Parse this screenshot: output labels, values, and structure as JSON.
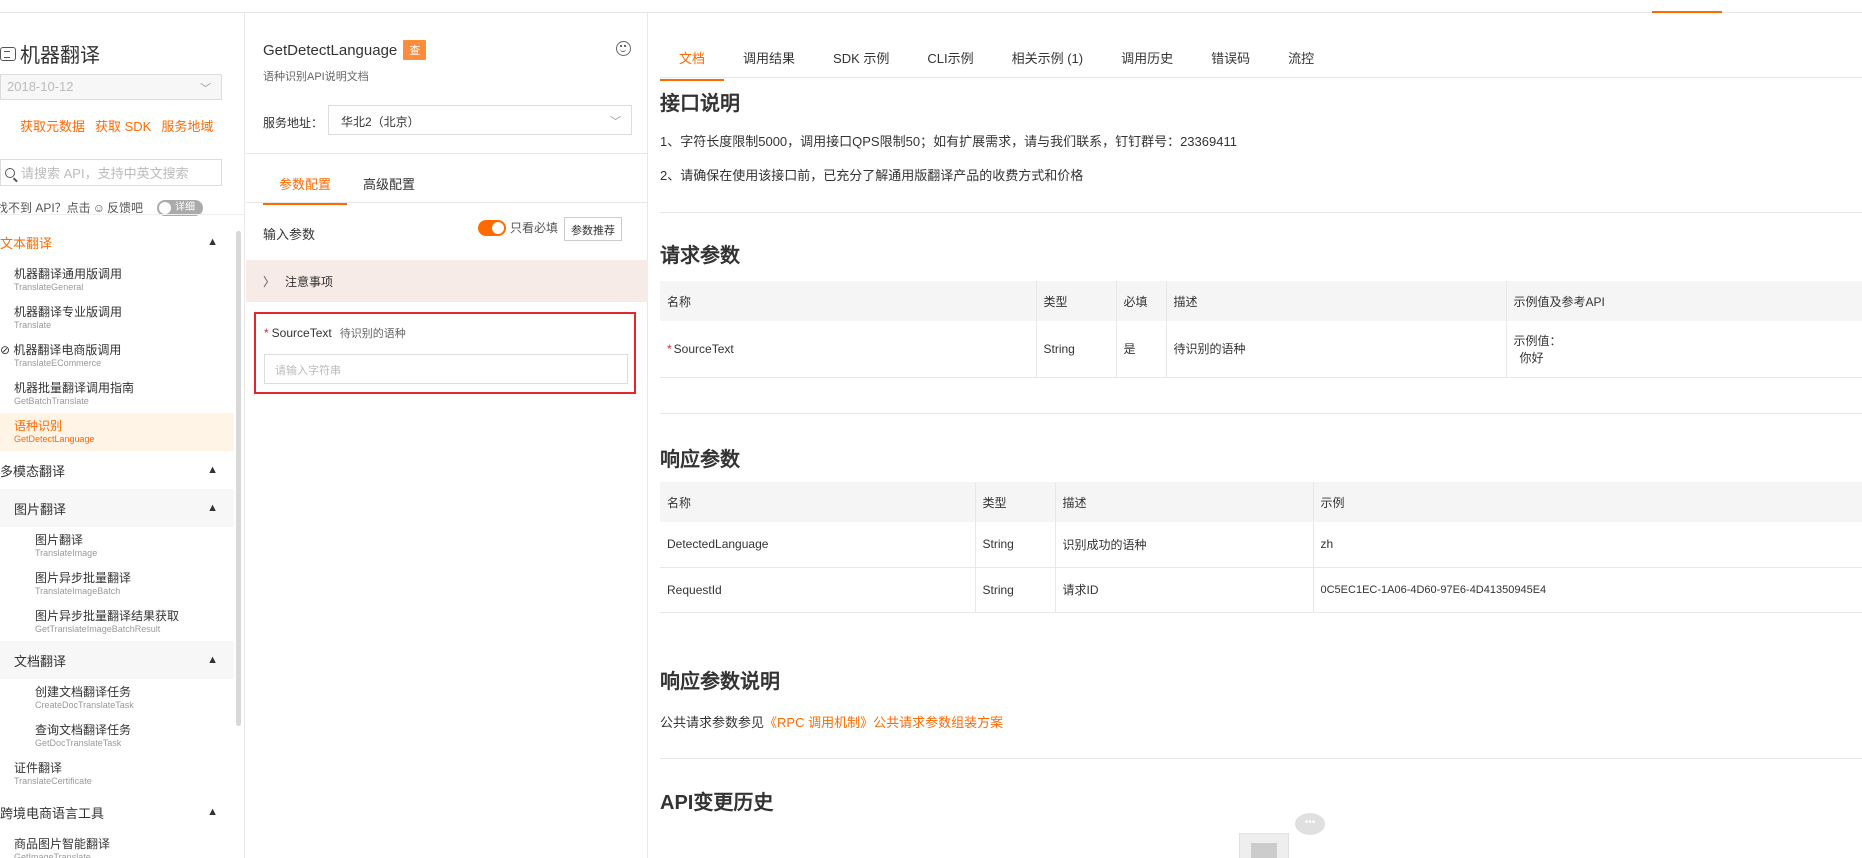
{
  "sidebar": {
    "title": "机器翻译",
    "date_value": "2018-10-12",
    "links": [
      "获取元数据",
      "获取 SDK",
      "服务地域"
    ],
    "search_placeholder": "请搜索 API，支持中英文搜索",
    "feedback_text": "找不到 API？点击",
    "feedback_link": "反馈吧",
    "detail_toggle": "详细",
    "nav": [
      {
        "type": "group",
        "label": "文本翻译",
        "active": true
      },
      {
        "type": "item",
        "cn": "机器翻译通用版调用",
        "en": "TranslateGeneral"
      },
      {
        "type": "item",
        "cn": "机器翻译专业版调用",
        "en": "Translate"
      },
      {
        "type": "item",
        "cn": "机器翻译电商版调用",
        "en": "TranslateECommerce",
        "disabled_icon": true
      },
      {
        "type": "item",
        "cn": "机器批量翻译调用指南",
        "en": "GetBatchTranslate"
      },
      {
        "type": "item",
        "cn": "语种识别",
        "en": "GetDetectLanguage",
        "active": true
      },
      {
        "type": "group",
        "label": "多模态翻译"
      },
      {
        "type": "subgroup",
        "label": "图片翻译"
      },
      {
        "type": "item",
        "deep": true,
        "cn": "图片翻译",
        "en": "TranslateImage"
      },
      {
        "type": "item",
        "deep": true,
        "cn": "图片异步批量翻译",
        "en": "TranslateImageBatch"
      },
      {
        "type": "item",
        "deep": true,
        "cn": "图片异步批量翻译结果获取",
        "en": "GetTranslateImageBatchResult"
      },
      {
        "type": "subgroup",
        "label": "文档翻译"
      },
      {
        "type": "item",
        "deep": true,
        "cn": "创建文档翻译任务",
        "en": "CreateDocTranslateTask"
      },
      {
        "type": "item",
        "deep": true,
        "cn": "查询文档翻译任务",
        "en": "GetDocTranslateTask"
      },
      {
        "type": "item",
        "cn": "证件翻译",
        "en": "TranslateCertificate"
      },
      {
        "type": "group",
        "label": "跨境电商语言工具"
      },
      {
        "type": "item",
        "cn": "商品图片智能翻译",
        "en": "GetImageTranslate"
      }
    ]
  },
  "middle": {
    "api_name": "GetDetectLanguage",
    "badge": "查",
    "subtitle": "语种识别API说明文档",
    "service_label": "服务地址：",
    "service_value": "华北2（北京）",
    "tabs": [
      "参数配置",
      "高级配置"
    ],
    "input_params_label": "输入参数",
    "only_required_label": "只看必填",
    "recommend_button": "参数推荐",
    "notes_label": "注意事项",
    "source_text": {
      "name": "SourceText",
      "desc": "待识别的语种",
      "placeholder": "请输入字符串"
    }
  },
  "right": {
    "tabs": [
      "文档",
      "调用结果",
      "SDK 示例",
      "CLI示例",
      "相关示例 (1)",
      "调用历史",
      "错误码",
      "流控"
    ],
    "intro_title": "接口说明",
    "intro_lines": [
      "1、字符长度限制5000，调用接口QPS限制50；如有扩展需求，请与我们联系，钉钉群号：23369411",
      "2、请确保在使用该接口前，已充分了解通用版翻译产品的收费方式和价格"
    ],
    "request_title": "请求参数",
    "request_headers": [
      "名称",
      "类型",
      "必填",
      "描述",
      "示例值及参考API"
    ],
    "request_rows": [
      {
        "name": "SourceText",
        "type": "String",
        "required": "是",
        "desc": "待识别的语种",
        "ex_label": "示例值：",
        "ex_value": "你好"
      }
    ],
    "response_title": "响应参数",
    "response_headers": [
      "名称",
      "类型",
      "描述",
      "示例"
    ],
    "response_rows": [
      {
        "name": "DetectedLanguage",
        "type": "String",
        "desc": "识别成功的语种",
        "example": "zh"
      },
      {
        "name": "RequestId",
        "type": "String",
        "desc": "请求ID",
        "example": "0C5EC1EC-1A06-4D60-97E6-4D41350945E4"
      }
    ],
    "resp_desc_title": "响应参数说明",
    "resp_desc_prefix": "公共请求参数参见",
    "resp_desc_link": "《RPC 调用机制》公共请求参数组装方案",
    "history_title": "API变更历史"
  },
  "colors": {
    "accent": "#ff6a00",
    "highlight_border": "#e3262d"
  }
}
